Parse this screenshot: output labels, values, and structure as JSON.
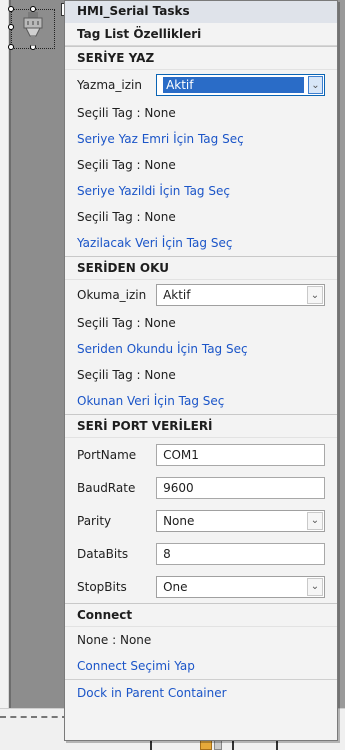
{
  "panel": {
    "title": "HMI_Serial Tasks",
    "subtitle": "Tag List Özellikleri"
  },
  "write_section": {
    "header": "SERİYE YAZ",
    "permission_label": "Yazma_izin",
    "permission_value": "Aktif",
    "items": [
      {
        "static": "Seçili Tag : None",
        "link": "Seriye Yaz Emri İçin Tag Seç"
      },
      {
        "static": "Seçili Tag : None",
        "link": "Seriye Yazildi İçin Tag Seç"
      },
      {
        "static": "Seçili Tag : None",
        "link": "Yazilacak Veri İçin Tag Seç"
      }
    ]
  },
  "read_section": {
    "header": "SERİDEN OKU",
    "permission_label": "Okuma_izin",
    "permission_value": "Aktif",
    "items": [
      {
        "static": "Seçili Tag : None",
        "link": "Seriden Okundu İçin Tag Seç"
      },
      {
        "static": "Seçili Tag : None",
        "link": "Okunan Veri İçin Tag Seç"
      }
    ]
  },
  "port_section": {
    "header": "SERİ PORT VERİLERİ",
    "port_name_label": "PortName",
    "port_name_value": "COM1",
    "baud_rate_label": "BaudRate",
    "baud_rate_value": "9600",
    "parity_label": "Parity",
    "parity_value": "None",
    "data_bits_label": "DataBits",
    "data_bits_value": "8",
    "stop_bits_label": "StopBits",
    "stop_bits_value": "One"
  },
  "connect_section": {
    "header": "Connect",
    "status": "None : None",
    "link": "Connect Seçimi Yap"
  },
  "dock_link": "Dock in Parent Container",
  "colors": {
    "link": "#1b55c8",
    "selection": "#2a6cc7",
    "panel_bg": "#f3f3f3",
    "canvas": "#8e8e8e"
  },
  "icons": {
    "component": "serial-port-icon",
    "smart_tag": "smart-tag-arrow-icon",
    "dropdown": "chevron-down-icon"
  }
}
